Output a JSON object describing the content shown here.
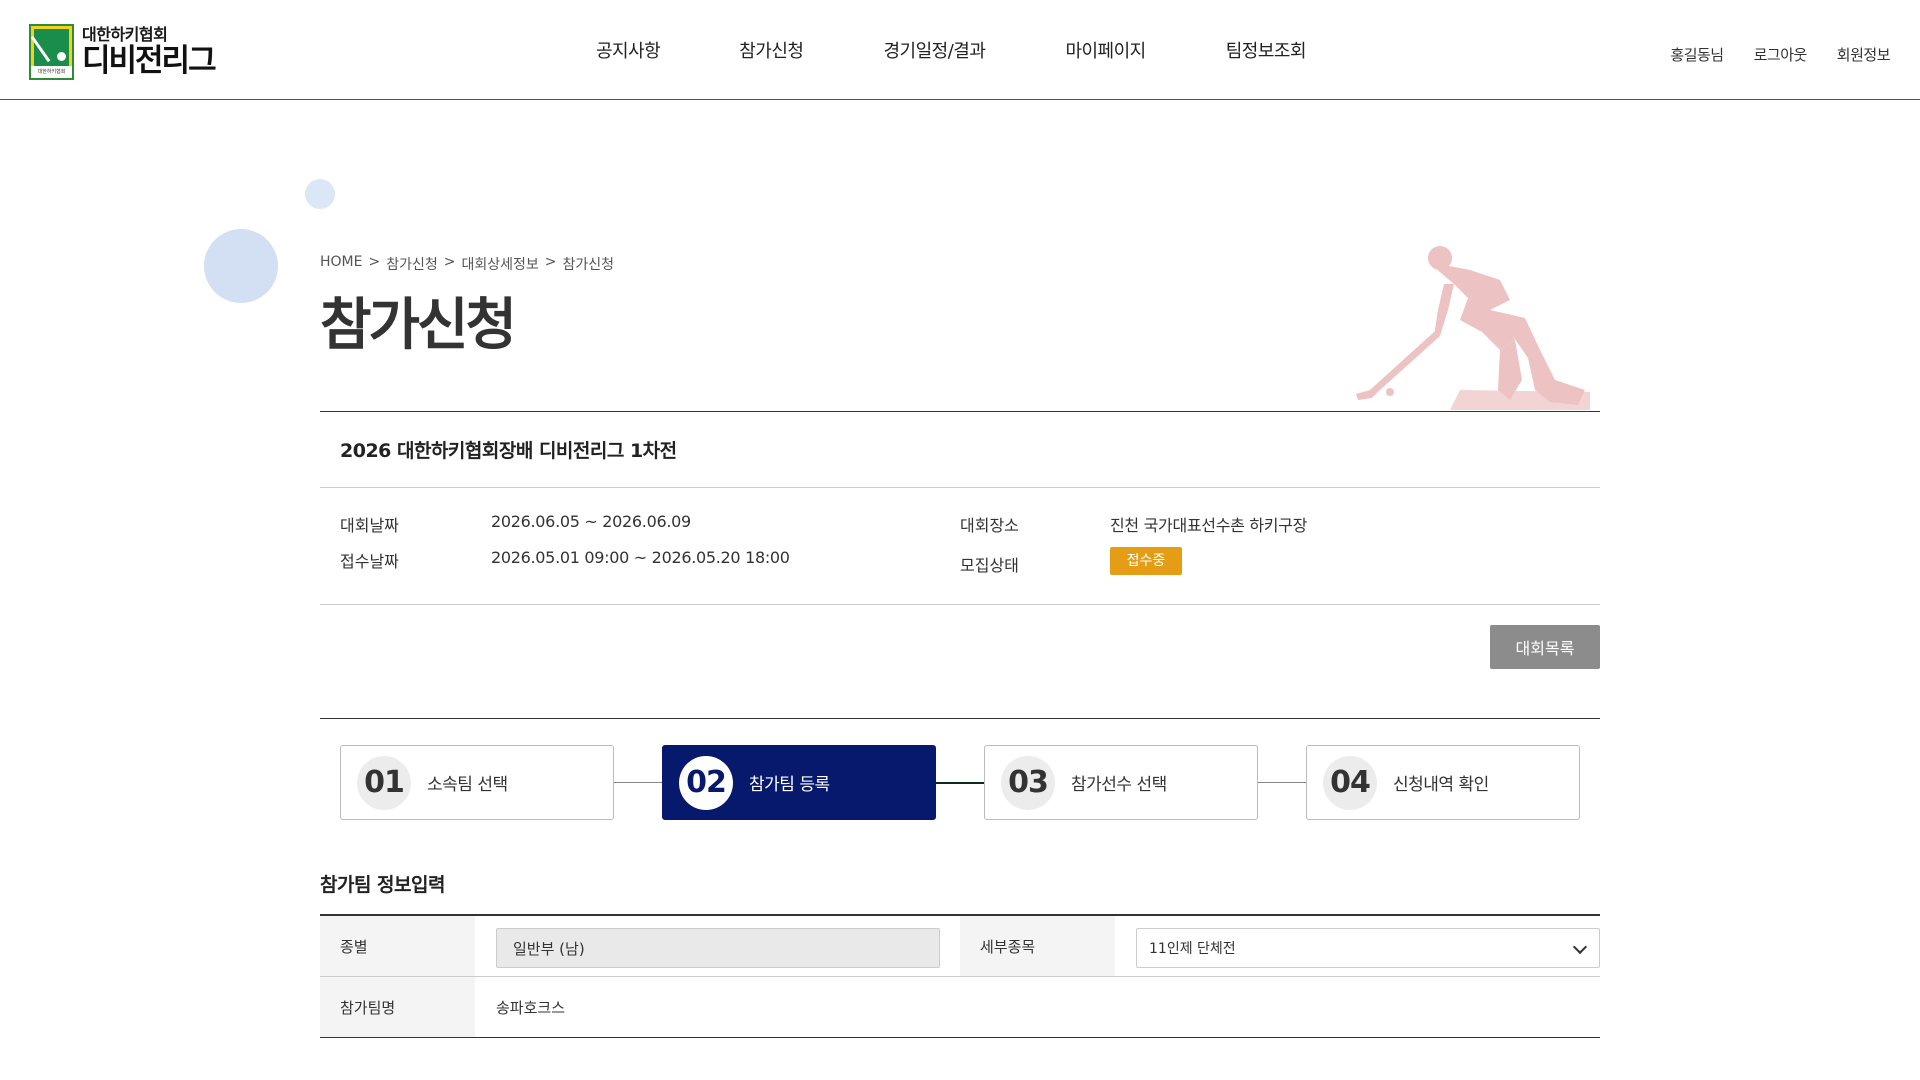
{
  "header": {
    "logo_sub": "대한하키협회",
    "logo_main": "디비전리그",
    "logo_badge": "대한하키협회",
    "nav": [
      "공지사항",
      "참가신청",
      "경기일정/결과",
      "마이페이지",
      "팀정보조회"
    ],
    "util": [
      "홍길동님",
      "로그아웃",
      "회원정보"
    ]
  },
  "breadcrumb": [
    "HOME",
    ">",
    "참가신청",
    ">",
    "대회상세정보",
    ">",
    "참가신청"
  ],
  "page_title": "참가신청",
  "competition": {
    "title": "2026 대한하키협회장배 디비전리그 1차전",
    "date_label": "대회날짜",
    "date_value": "2026.06.05 ~ 2026.06.09",
    "reg_label": "접수날짜",
    "reg_value": "2026.05.01 09:00 ~ 2026.05.20 18:00",
    "venue_label": "대회장소",
    "venue_value": "진천 국가대표선수촌 하키구장",
    "status_label": "모집상태",
    "status_value": "접수중",
    "status_color": "#e69d16"
  },
  "list_button": "대회목록",
  "steps": [
    {
      "num": "01",
      "label": "소속팀 선택"
    },
    {
      "num": "02",
      "label": "참가팀 등록"
    },
    {
      "num": "03",
      "label": "참가선수 선택"
    },
    {
      "num": "04",
      "label": "신청내역 확인"
    }
  ],
  "active_step_color": "#07196d",
  "form": {
    "section_title": "참가팀 정보입력",
    "category_label": "종별",
    "category_value": "일반부 (남)",
    "event_label": "세부종목",
    "event_value": "11인제 단체전",
    "team_label": "참가팀명",
    "team_value": "송파호크스"
  }
}
